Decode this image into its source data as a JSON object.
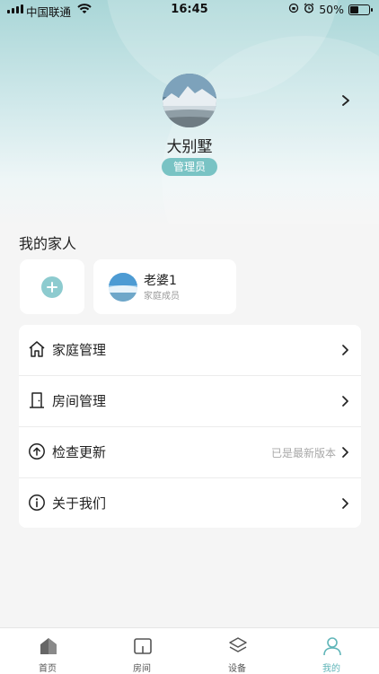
{
  "status_bar": {
    "carrier": "中国联通",
    "time": "16:45",
    "battery_percent": "50%",
    "battery_level": 0.5
  },
  "profile": {
    "home_name": "大别墅",
    "role_badge": "管理员"
  },
  "family": {
    "section_title": "我的家人",
    "members": [
      {
        "name": "老婆1",
        "role": "家庭成员"
      }
    ]
  },
  "menu": {
    "items": [
      {
        "label": "家庭管理",
        "value": "",
        "icon": "home-outline-icon"
      },
      {
        "label": "房间管理",
        "value": "",
        "icon": "door-icon"
      },
      {
        "label": "检查更新",
        "value": "已是最新版本",
        "icon": "upload-circle-icon"
      },
      {
        "label": "关于我们",
        "value": "",
        "icon": "info-circle-icon"
      }
    ]
  },
  "tabbar": {
    "tabs": [
      {
        "label": "首页",
        "icon": "home-icon",
        "active": false
      },
      {
        "label": "房间",
        "icon": "room-icon",
        "active": false
      },
      {
        "label": "设备",
        "icon": "layers-icon",
        "active": false
      },
      {
        "label": "我的",
        "icon": "user-icon",
        "active": true
      }
    ]
  },
  "colors": {
    "accent": "#79c3c4",
    "active_tab": "#5fb5b8",
    "header_top": "#a9d6d7"
  }
}
